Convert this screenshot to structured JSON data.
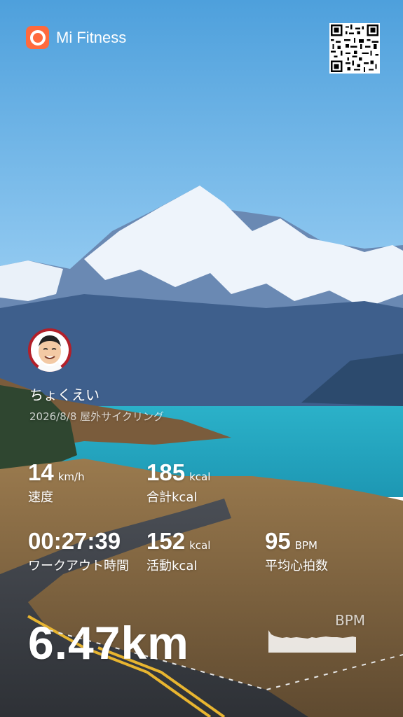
{
  "app": {
    "name": "Mi Fitness",
    "logo_icon": "mi-fitness-logo-icon",
    "accent": "#ff6a3d"
  },
  "qr_icon": "qr-code-icon",
  "user": {
    "name": "ちょくえい",
    "avatar_icon": "avatar-cartoon-icon"
  },
  "workout": {
    "date": "2026/8/8",
    "type": "屋外サイクリング"
  },
  "metrics": {
    "speed": {
      "value": "14",
      "unit": "km/h",
      "label": "速度"
    },
    "total_kcal": {
      "value": "185",
      "unit": "kcal",
      "label": "合計kcal"
    },
    "duration": {
      "value": "00:27:39",
      "label": "ワークアウト時間"
    },
    "active_kcal": {
      "value": "152",
      "unit": "kcal",
      "label": "活動kcal"
    },
    "avg_hr": {
      "value": "95",
      "unit": "BPM",
      "label": "平均心拍数"
    }
  },
  "distance": "6.47km",
  "hr_chart": {
    "label": "BPM"
  }
}
